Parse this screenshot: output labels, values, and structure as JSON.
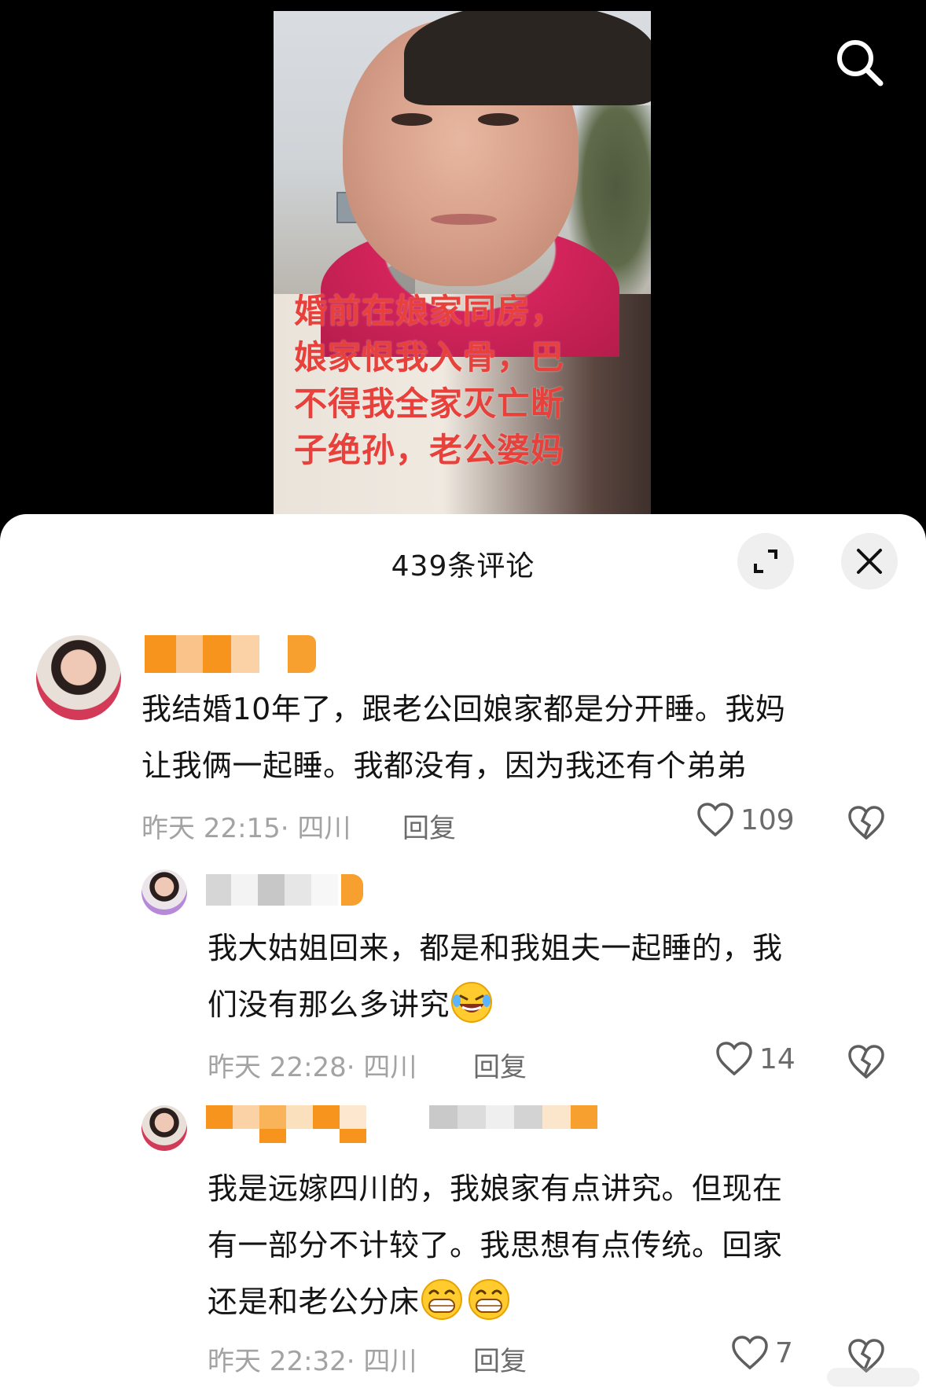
{
  "video": {
    "overlay_lines": [
      "婚前在娘家同房，",
      "娘家恨我入骨，巴",
      "不得我全家灭亡断",
      "子绝孙，老公婆妈"
    ]
  },
  "header": {
    "comment_count_title": "439条评论"
  },
  "icons": {
    "search": "search-icon",
    "expand": "expand-icon",
    "close": "close-icon",
    "like": "heart-icon",
    "dislike": "broken-heart-icon",
    "emoji_laugh_cry": "laughing-crying-emoji",
    "emoji_grin": "grinning-emoji"
  },
  "colors": {
    "sheet_bg": "#ffffff",
    "text": "#141414",
    "meta": "#a3a3a3",
    "overlay_text": "#e8403a",
    "name_blur_orange": "#f7941d"
  },
  "comments": [
    {
      "text_lines": [
        "我结婚10年了，跟老公回娘家都是分开睡。我妈",
        "让我俩一起睡。我都没有，因为我还有个弟弟"
      ],
      "time": "昨天 22:15",
      "location": "· 四川",
      "reply_label": "回复",
      "likes": "109"
    },
    {
      "text_lines": [
        "我大姑姐回来，都是和我姐夫一起睡的，我",
        "们没有那么多讲究"
      ],
      "time": "昨天 22:28",
      "location": "· 四川",
      "reply_label": "回复",
      "likes": "14"
    },
    {
      "text_lines": [
        "我是远嫁四川的，我娘家有点讲究。但现在",
        "有一部分不计较了。我思想有点传统。回家",
        "还是和老公分床"
      ],
      "time": "昨天 22:32",
      "location": "· 四川",
      "reply_label": "回复",
      "likes": "7"
    }
  ]
}
